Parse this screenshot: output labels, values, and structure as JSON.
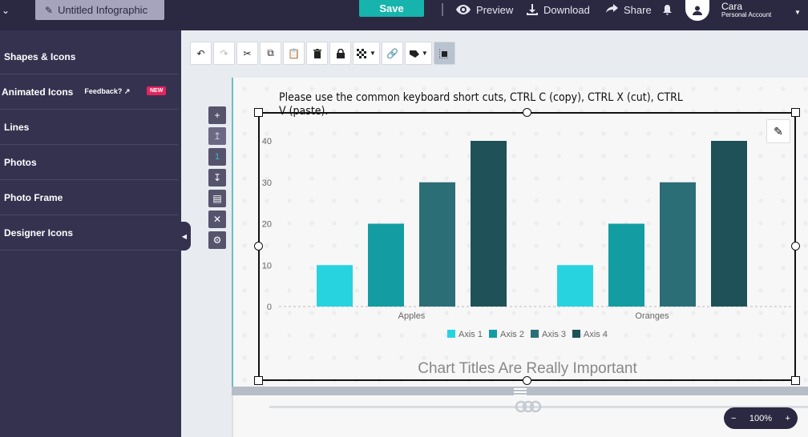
{
  "topbar": {
    "doc_title": "Untitled Infographic",
    "save_label": "Save",
    "preview_label": "Preview",
    "download_label": "Download",
    "share_label": "Share",
    "user_name": "Cara",
    "user_plan": "Personal Account"
  },
  "sidebar": {
    "items": [
      {
        "label": "Shapes & Icons"
      },
      {
        "label": "Animated Icons",
        "extra": "Feedback?",
        "badge": "NEW"
      },
      {
        "label": "Lines"
      },
      {
        "label": "Photos"
      },
      {
        "label": "Photo Frame"
      },
      {
        "label": "Designer Icons"
      }
    ]
  },
  "minibar": {
    "page_number": "1"
  },
  "canvas": {
    "instruction": "Please use the common keyboard short cuts, CTRL C (copy), CTRL X (cut), CTRL V (paste)."
  },
  "zoom": {
    "minus": "−",
    "level": "100%",
    "plus": "+"
  },
  "colors": {
    "axis1": "#28d3e0",
    "axis2": "#139ca1",
    "axis3": "#2c6e76",
    "axis4": "#1f5158",
    "accent": "#16b4ac"
  },
  "chart_data": {
    "type": "bar",
    "categories": [
      "Apples",
      "Oranges"
    ],
    "series": [
      {
        "name": "Axis 1",
        "values": [
          10,
          10
        ]
      },
      {
        "name": "Axis 2",
        "values": [
          20,
          20
        ]
      },
      {
        "name": "Axis 3",
        "values": [
          30,
          30
        ]
      },
      {
        "name": "Axis 4",
        "values": [
          40,
          40
        ]
      }
    ],
    "yticks": [
      "0",
      "10",
      "20",
      "30",
      "40"
    ],
    "ylim": [
      0,
      40
    ],
    "legend": "bottom",
    "grid": false,
    "title": "Chart Titles Are Really Important"
  }
}
